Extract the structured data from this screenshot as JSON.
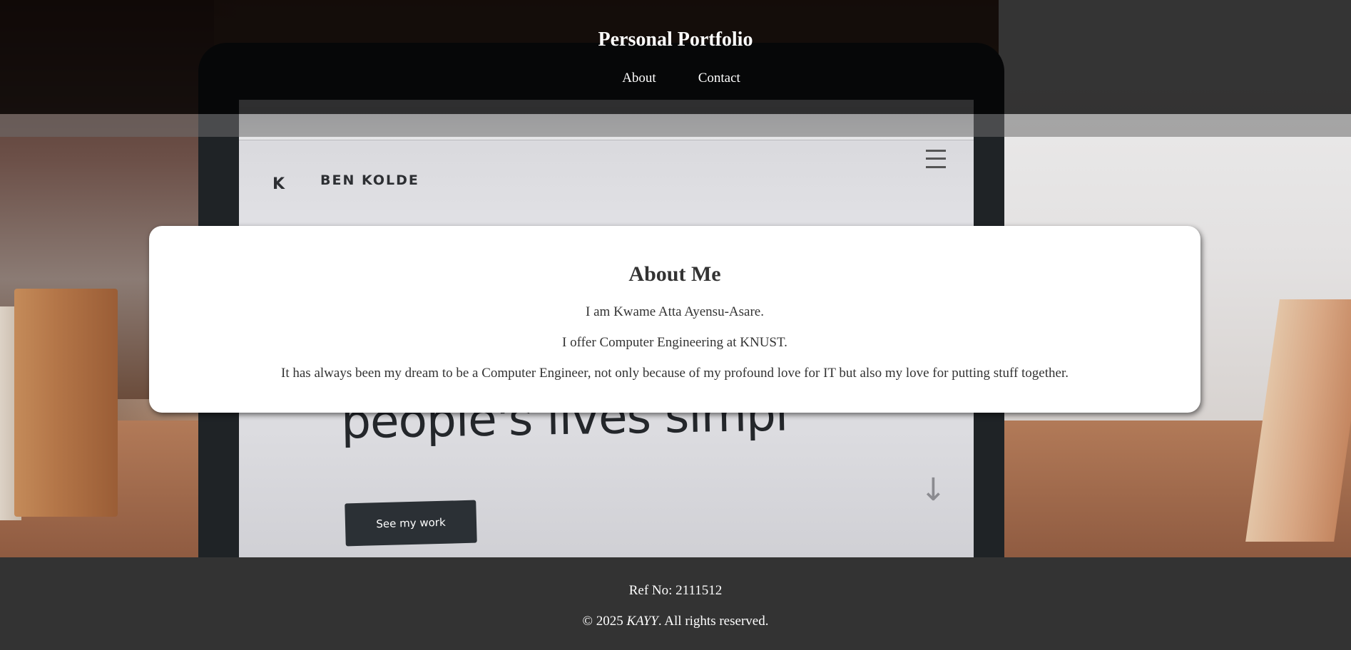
{
  "header": {
    "title": "Personal Portfolio",
    "nav": [
      {
        "label": "About"
      },
      {
        "label": "Contact"
      }
    ]
  },
  "background": {
    "screen_logo": "K",
    "screen_brand": "BEN KOLDE",
    "screen_headline": "people's lives simpl",
    "screen_button": "See my work",
    "screen_arrow": "↓"
  },
  "about": {
    "heading": "About Me",
    "paragraphs": [
      "I am Kwame Atta Ayensu-Asare.",
      "I offer Computer Engineering at KNUST.",
      "It has always been my dream to be a Computer Engineer, not only because of my profound love for IT but also my love for putting stuff together."
    ]
  },
  "footer": {
    "ref": "Ref No: 2111512",
    "copyright_prefix": "© 2025 ",
    "copyright_name": "KAYY",
    "copyright_suffix": ". All rights reserved."
  },
  "colors": {
    "header_bg": "#000000",
    "footer_bg": "#333333",
    "card_bg": "#ffffff",
    "text_dark": "#333333"
  }
}
